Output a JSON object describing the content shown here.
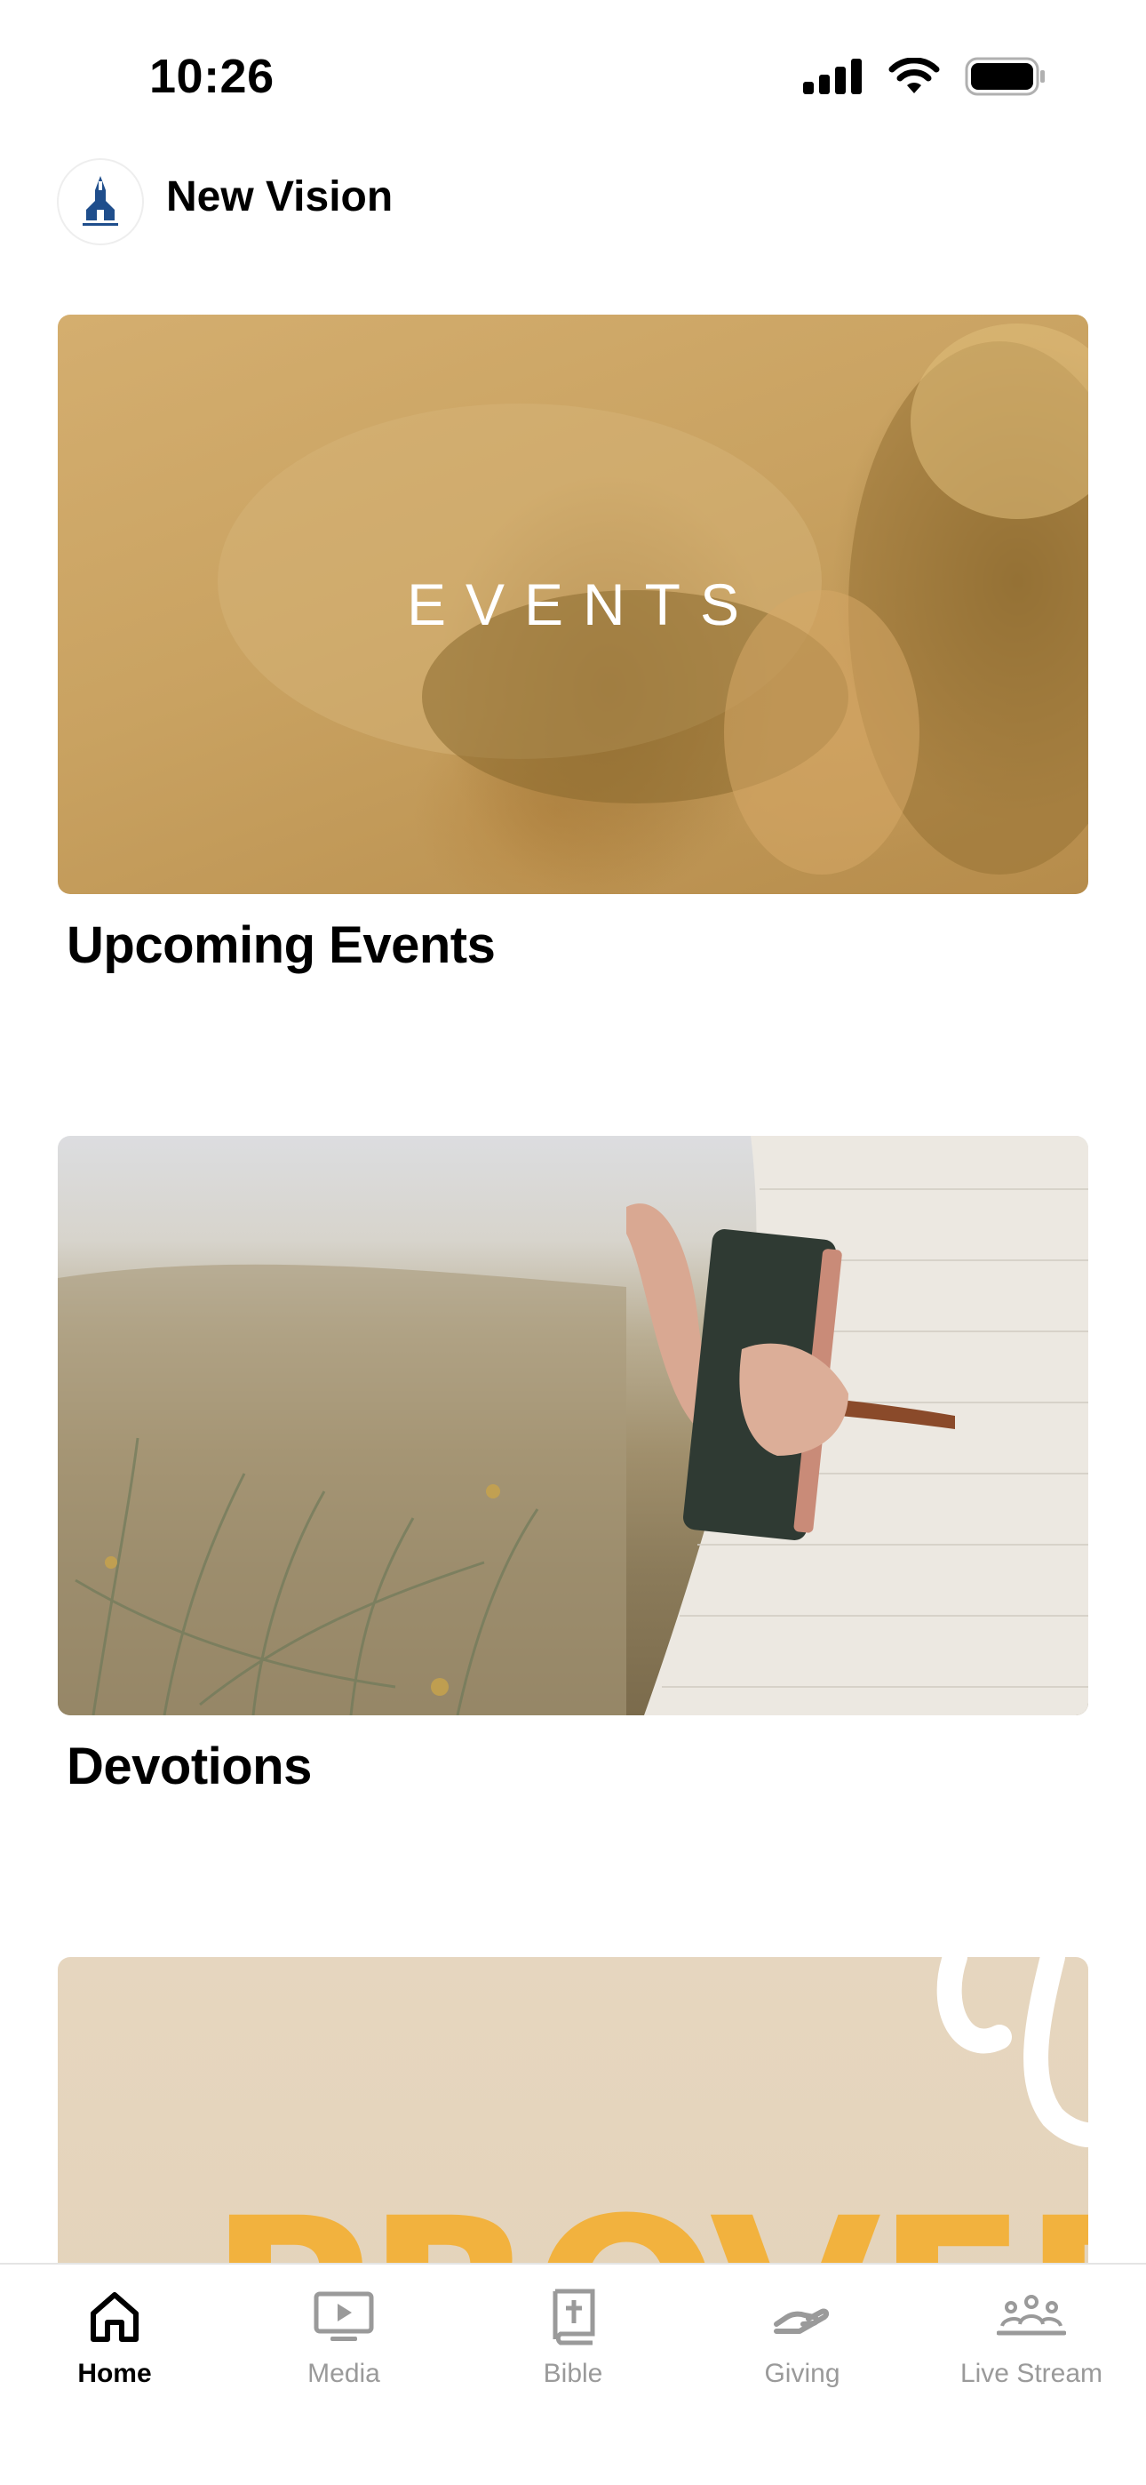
{
  "status_bar": {
    "time": "10:26"
  },
  "header": {
    "title": "New Vision"
  },
  "cards": [
    {
      "overlay_text": "EVENTS",
      "title": "Upcoming Events"
    },
    {
      "overlay_text": "",
      "title": "Devotions"
    },
    {
      "overlay_text": "PROVERB",
      "title": ""
    }
  ],
  "tabs": [
    {
      "label": "Home",
      "icon": "home-icon",
      "active": true
    },
    {
      "label": "Media",
      "icon": "media-icon",
      "active": false
    },
    {
      "label": "Bible",
      "icon": "bible-icon",
      "active": false
    },
    {
      "label": "Giving",
      "icon": "giving-icon",
      "active": false
    },
    {
      "label": "Live Stream",
      "icon": "live-stream-icon",
      "active": false
    }
  ],
  "colors": {
    "active_tab": "#000000",
    "inactive_tab": "#9a9a9a",
    "events_tint": "#c9a261",
    "proverbs_accent": "#f2b23e",
    "logo_blue": "#1f4e8c"
  }
}
